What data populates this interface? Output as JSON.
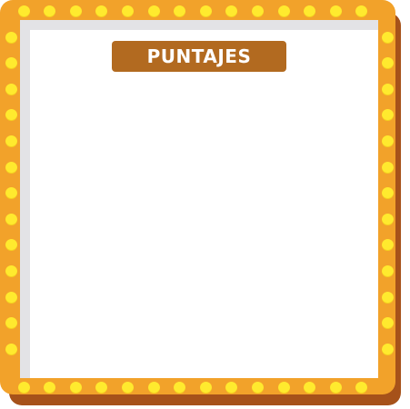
{
  "board": {
    "title": "PUNTAJES",
    "frame_color": "#f2a22a",
    "shadow_color": "#a6521a",
    "bulb_color": "#ffea2e",
    "plate_color": "#b26a20",
    "screen_color": "#ffffff",
    "scores": []
  }
}
